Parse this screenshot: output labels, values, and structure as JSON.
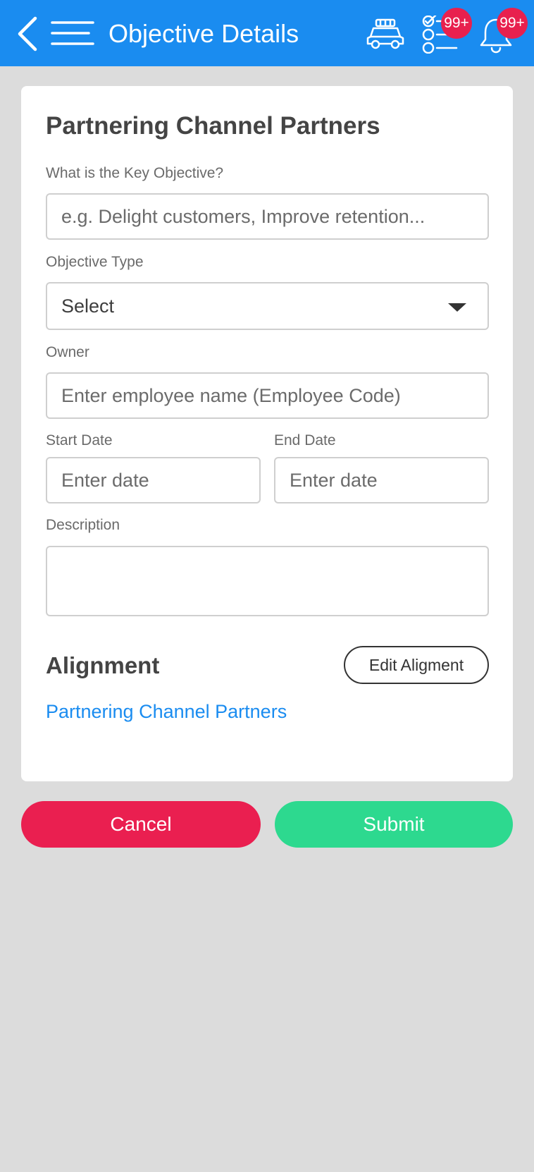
{
  "colors": {
    "app_bar": "#1a8cf0",
    "badge": "#e8204e",
    "cancel": "#ea1f50",
    "submit": "#2dd98f",
    "link": "#1a8cf0"
  },
  "header": {
    "title": "Objective Details",
    "icons": [
      "back-icon",
      "menu-icon",
      "car-icon",
      "task-list-icon",
      "bell-icon"
    ],
    "tasks_badge": "99+",
    "notifications_badge": "99+"
  },
  "form": {
    "title": "Partnering Channel Partners",
    "key_objective": {
      "label": "What is the Key Objective?",
      "placeholder": "e.g. Delight customers, Improve retention..."
    },
    "objective_type": {
      "label": "Objective Type",
      "value": "Select"
    },
    "owner": {
      "label": "Owner",
      "placeholder": "Enter employee name (Employee Code)"
    },
    "start_date": {
      "label": "Start Date",
      "placeholder": "Enter date"
    },
    "end_date": {
      "label": "End Date",
      "placeholder": "Enter date"
    },
    "description": {
      "label": "Description",
      "value": ""
    }
  },
  "alignment": {
    "title": "Alignment",
    "edit_label": "Edit Aligment",
    "link": "Partnering Channel Partners"
  },
  "actions": {
    "cancel": "Cancel",
    "submit": "Submit"
  }
}
